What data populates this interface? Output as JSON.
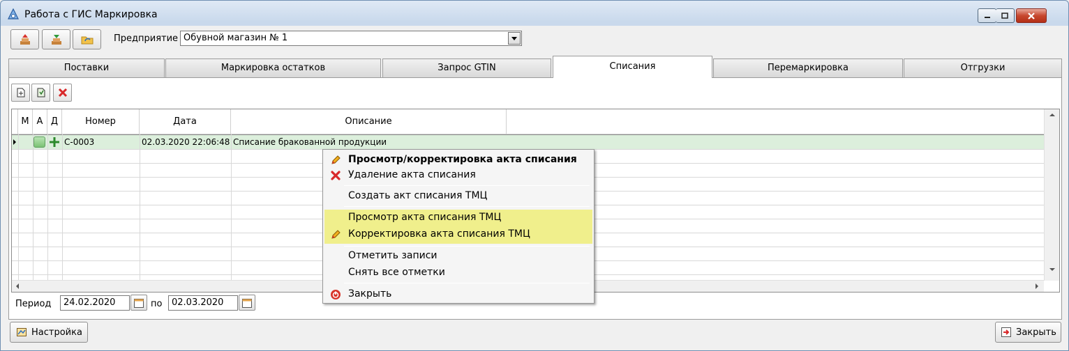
{
  "window": {
    "title": "Работа с ГИС Маркировка"
  },
  "toolbar": {
    "company_label": "Предприятие",
    "company_value": "Обувной магазин № 1"
  },
  "tabs": [
    {
      "label": "Поставки"
    },
    {
      "label": "Маркировка остатков"
    },
    {
      "label": "Запрос GTIN"
    },
    {
      "label": "Списания"
    },
    {
      "label": "Перемаркировка"
    },
    {
      "label": "Отгрузки"
    }
  ],
  "grid": {
    "columns": [
      "М",
      "А",
      "Д",
      "Номер",
      "Дата",
      "Описание"
    ],
    "rows": [
      {
        "number": "С-0003",
        "date": "02.03.2020 22:06:48",
        "description": "Списание бракованной продукции"
      }
    ]
  },
  "period": {
    "label": "Период",
    "from": "24.02.2020",
    "to_label": "по",
    "to": "02.03.2020"
  },
  "buttons": {
    "settings": "Настройка",
    "close": "Закрыть"
  },
  "context_menu": {
    "items": [
      "Просмотр/корректировка акта списания",
      "Удаление акта списания",
      "Создать акт списания ТМЦ",
      "Просмотр акта списания ТМЦ",
      "Корректировка акта списания ТМЦ",
      "Отметить записи",
      "Снять все отметки",
      "Закрыть"
    ]
  },
  "colors": {
    "selected_row": "#dcefdc",
    "menu_highlight": "#f0ef8c",
    "delete_red": "#d8282a"
  }
}
